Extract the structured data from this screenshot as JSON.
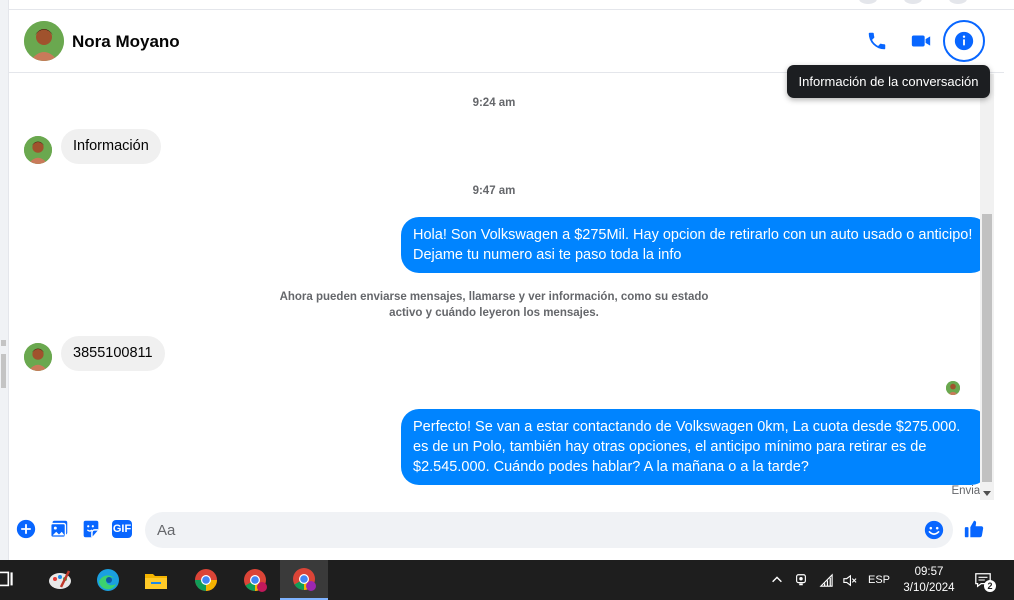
{
  "header": {
    "contact_name": "Nora Moyano",
    "tooltip": "Información de la conversación",
    "icons": [
      "phone-icon",
      "video-icon",
      "info-icon"
    ]
  },
  "thread": {
    "time_1": "9:24 am",
    "msg_in_1": "Información",
    "time_2": "9:47 am",
    "msg_out_1": "Hola! Son Volkswagen a $275Mil. Hay opcion de retirarlo con un auto usado o anticipo! Dejame tu numero asi te paso toda la info",
    "system_note": "Ahora pueden enviarse mensajes, llamarse y ver información, como su estado activo y cuándo leyeron los mensajes.",
    "msg_in_2": "3855100811",
    "msg_out_2": "Perfecto!  Se van a estar contactando de Volkswagen 0km, La cuota desde $275.000. es de un Polo, también hay otras opciones, el anticipo mínimo para retirar es de $2.545.000. Cuándo podes hablar? A la mañana o a la tarde?",
    "status": "Enviado"
  },
  "composer": {
    "placeholder": "Aa",
    "gif_label": "GIF",
    "icons": [
      "plus-icon",
      "photo-icon",
      "sticker-icon",
      "gif-icon",
      "emoji-icon",
      "like-icon"
    ]
  },
  "taskbar": {
    "language": "ESP",
    "time": "09:57",
    "date": "3/10/2024",
    "notification_count": "2"
  },
  "colors": {
    "accent": "#0866ff",
    "outgoing_bubble": "#0084ff",
    "incoming_bubble": "#f0f0f0"
  }
}
